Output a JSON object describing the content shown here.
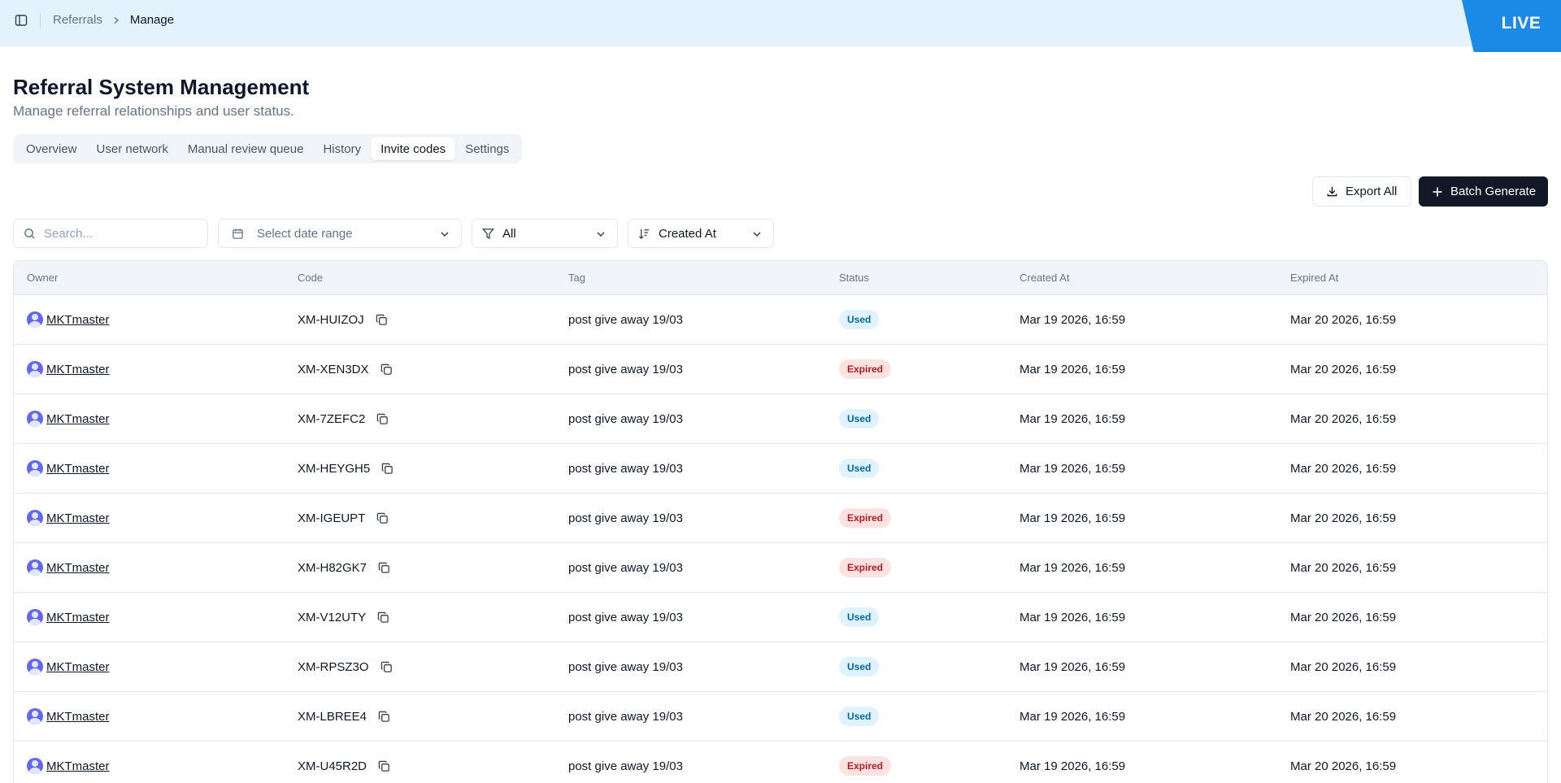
{
  "breadcrumb": {
    "parent": "Referrals",
    "current": "Manage"
  },
  "env_badge": "LIVE",
  "page": {
    "title": "Referral System Management",
    "subtitle": "Manage referral relationships and user status."
  },
  "tabs": [
    {
      "label": "Overview",
      "active": false
    },
    {
      "label": "User network",
      "active": false
    },
    {
      "label": "Manual review queue",
      "active": false
    },
    {
      "label": "History",
      "active": false
    },
    {
      "label": "Invite codes",
      "active": true
    },
    {
      "label": "Settings",
      "active": false
    }
  ],
  "actions": {
    "export_label": "Export All",
    "batch_label": "Batch Generate"
  },
  "filters": {
    "search_placeholder": "Search...",
    "date_placeholder": "Select date range",
    "status_value": "All",
    "sort_value": "Created At"
  },
  "table": {
    "columns": [
      "Owner",
      "Code",
      "Tag",
      "Status",
      "Created At",
      "Expired At"
    ],
    "rows": [
      {
        "owner": "MKTmaster",
        "code": "XM-HUIZOJ",
        "tag": "post give away 19/03",
        "status": "Used",
        "created": "Mar 19 2026, 16:59",
        "expired": "Mar 20 2026, 16:59"
      },
      {
        "owner": "MKTmaster",
        "code": "XM-XEN3DX",
        "tag": "post give away 19/03",
        "status": "Expired",
        "created": "Mar 19 2026, 16:59",
        "expired": "Mar 20 2026, 16:59"
      },
      {
        "owner": "MKTmaster",
        "code": "XM-7ZEFC2",
        "tag": "post give away 19/03",
        "status": "Used",
        "created": "Mar 19 2026, 16:59",
        "expired": "Mar 20 2026, 16:59"
      },
      {
        "owner": "MKTmaster",
        "code": "XM-HEYGH5",
        "tag": "post give away 19/03",
        "status": "Used",
        "created": "Mar 19 2026, 16:59",
        "expired": "Mar 20 2026, 16:59"
      },
      {
        "owner": "MKTmaster",
        "code": "XM-IGEUPT",
        "tag": "post give away 19/03",
        "status": "Expired",
        "created": "Mar 19 2026, 16:59",
        "expired": "Mar 20 2026, 16:59"
      },
      {
        "owner": "MKTmaster",
        "code": "XM-H82GK7",
        "tag": "post give away 19/03",
        "status": "Expired",
        "created": "Mar 19 2026, 16:59",
        "expired": "Mar 20 2026, 16:59"
      },
      {
        "owner": "MKTmaster",
        "code": "XM-V12UTY",
        "tag": "post give away 19/03",
        "status": "Used",
        "created": "Mar 19 2026, 16:59",
        "expired": "Mar 20 2026, 16:59"
      },
      {
        "owner": "MKTmaster",
        "code": "XM-RPSZ3O",
        "tag": "post give away 19/03",
        "status": "Used",
        "created": "Mar 19 2026, 16:59",
        "expired": "Mar 20 2026, 16:59"
      },
      {
        "owner": "MKTmaster",
        "code": "XM-LBREE4",
        "tag": "post give away 19/03",
        "status": "Used",
        "created": "Mar 19 2026, 16:59",
        "expired": "Mar 20 2026, 16:59"
      },
      {
        "owner": "MKTmaster",
        "code": "XM-U45R2D",
        "tag": "post give away 19/03",
        "status": "Expired",
        "created": "Mar 19 2026, 16:59",
        "expired": "Mar 20 2026, 16:59"
      }
    ]
  },
  "colors": {
    "live": "#1a8ae6",
    "topbar": "#e3f2fc",
    "used_bg": "#e0f2fe",
    "used_fg": "#0369a1",
    "expired_bg": "#fee2e2",
    "expired_fg": "#b91c1c",
    "primary_btn": "#111827"
  }
}
